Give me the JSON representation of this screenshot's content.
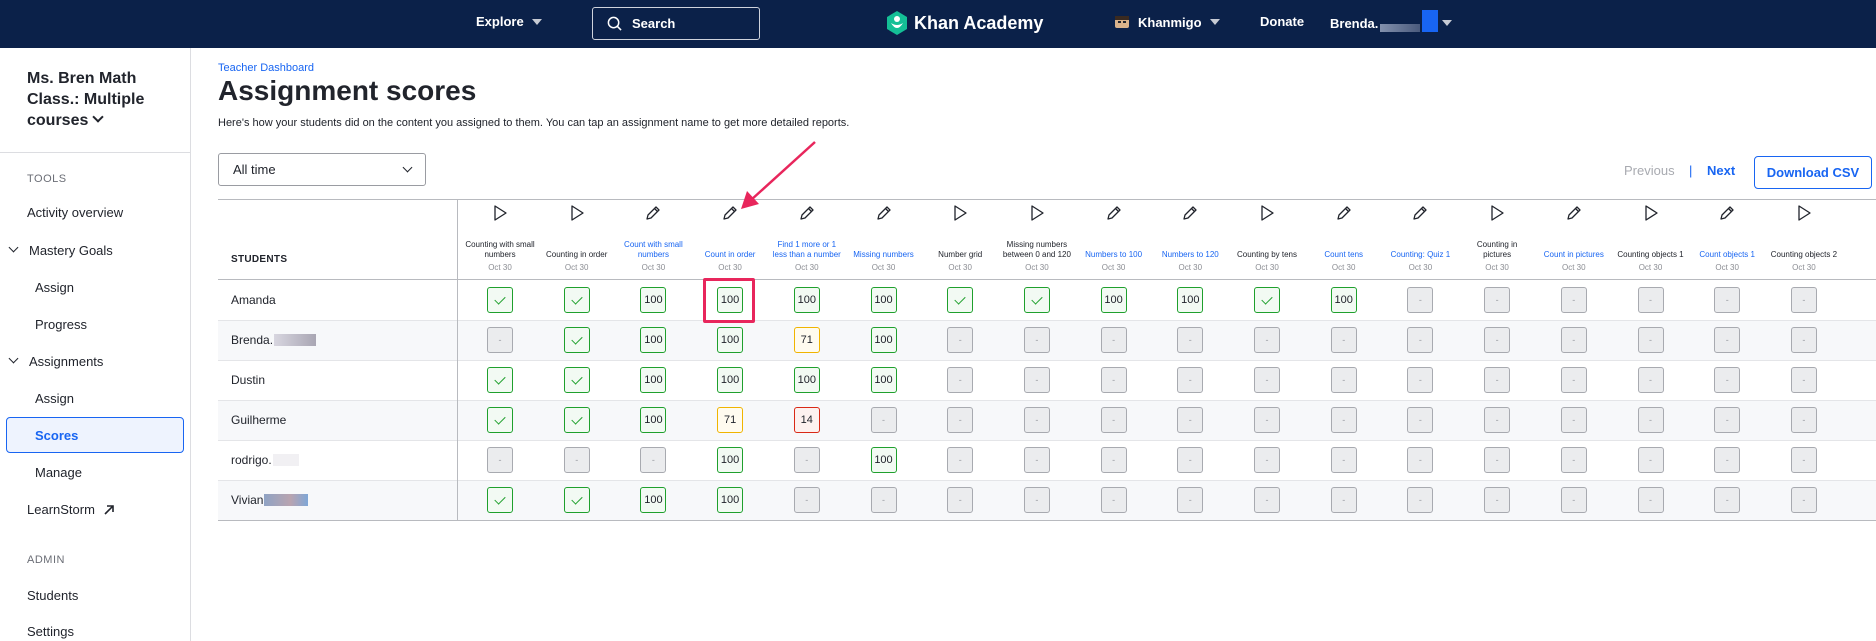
{
  "topbar": {
    "explore": "Explore",
    "search_placeholder": "Search",
    "logo": "Khan Academy",
    "khanmigo": "Khanmigo",
    "donate": "Donate",
    "user": "Brenda."
  },
  "sidebar": {
    "class_title": "Ms. Bren Math Class.: Multiple courses",
    "tools_label": "TOOLS",
    "activity_overview": "Activity overview",
    "mastery_goals": "Mastery Goals",
    "mastery_assign": "Assign",
    "mastery_progress": "Progress",
    "assignments": "Assignments",
    "assignments_assign": "Assign",
    "scores": "Scores",
    "manage": "Manage",
    "learnstorm": "LearnStorm",
    "admin_label": "ADMIN",
    "students": "Students",
    "settings": "Settings"
  },
  "main": {
    "breadcrumb": "Teacher Dashboard",
    "title": "Assignment scores",
    "subtitle": "Here's how your students did on the content you assigned to them. You can tap an assignment name to get more detailed reports.",
    "time_filter": "All time",
    "previous": "Previous",
    "separator": "|",
    "next": "Next",
    "download_csv": "Download CSV",
    "students_header": "STUDENTS"
  },
  "columns": [
    {
      "name": "Counting with small numbers",
      "date": "Oct 30",
      "icon": "play-icon",
      "linked": false
    },
    {
      "name": "Counting in order",
      "date": "Oct 30",
      "icon": "play-icon",
      "linked": false
    },
    {
      "name": "Count with small numbers",
      "date": "Oct 30",
      "icon": "pencil-icon",
      "linked": true
    },
    {
      "name": "Count in order",
      "date": "Oct 30",
      "icon": "pencil-icon",
      "linked": true
    },
    {
      "name": "Find 1 more or 1 less than a number",
      "date": "Oct 30",
      "icon": "pencil-icon",
      "linked": true
    },
    {
      "name": "Missing numbers",
      "date": "Oct 30",
      "icon": "pencil-icon",
      "linked": true
    },
    {
      "name": "Number grid",
      "date": "Oct 30",
      "icon": "play-icon",
      "linked": false
    },
    {
      "name": "Missing numbers between 0 and 120",
      "date": "Oct 30",
      "icon": "play-icon",
      "linked": false
    },
    {
      "name": "Numbers to 100",
      "date": "Oct 30",
      "icon": "pencil-icon",
      "linked": true
    },
    {
      "name": "Numbers to 120",
      "date": "Oct 30",
      "icon": "pencil-icon",
      "linked": true
    },
    {
      "name": "Counting by tens",
      "date": "Oct 30",
      "icon": "play-icon",
      "linked": false
    },
    {
      "name": "Count tens",
      "date": "Oct 30",
      "icon": "pencil-icon",
      "linked": true
    },
    {
      "name": "Counting: Quiz 1",
      "date": "Oct 30",
      "icon": "pencil-icon",
      "linked": true
    },
    {
      "name": "Counting in pictures",
      "date": "Oct 30",
      "icon": "play-icon",
      "linked": false
    },
    {
      "name": "Count in pictures",
      "date": "Oct 30",
      "icon": "pencil-icon",
      "linked": true
    },
    {
      "name": "Counting objects 1",
      "date": "Oct 30",
      "icon": "play-icon",
      "linked": false
    },
    {
      "name": "Count objects 1",
      "date": "Oct 30",
      "icon": "pencil-icon",
      "linked": true
    },
    {
      "name": "Counting objects 2",
      "date": "Oct 30",
      "icon": "play-icon",
      "linked": false
    }
  ],
  "students": [
    {
      "name": "Amanda",
      "scores": [
        "check",
        "check",
        "100",
        "100",
        "100",
        "100",
        "check",
        "check",
        "100",
        "100",
        "check",
        "100",
        "-",
        "-",
        "-",
        "-",
        "-",
        "-"
      ]
    },
    {
      "name": "Brenda.",
      "scores": [
        "-",
        "check",
        "100",
        "100",
        "71",
        "100",
        "-",
        "-",
        "-",
        "-",
        "-",
        "-",
        "-",
        "-",
        "-",
        "-",
        "-",
        "-"
      ]
    },
    {
      "name": "Dustin",
      "scores": [
        "check",
        "check",
        "100",
        "100",
        "100",
        "100",
        "-",
        "-",
        "-",
        "-",
        "-",
        "-",
        "-",
        "-",
        "-",
        "-",
        "-",
        "-"
      ]
    },
    {
      "name": "Guilherme",
      "scores": [
        "check",
        "check",
        "100",
        "71",
        "14",
        "-",
        "-",
        "-",
        "-",
        "-",
        "-",
        "-",
        "-",
        "-",
        "-",
        "-",
        "-",
        "-"
      ]
    },
    {
      "name": "rodrigo.",
      "scores": [
        "-",
        "-",
        "-",
        "100",
        "-",
        "100",
        "-",
        "-",
        "-",
        "-",
        "-",
        "-",
        "-",
        "-",
        "-",
        "-",
        "-",
        "-"
      ]
    },
    {
      "name": "Vivian",
      "scores": [
        "check",
        "check",
        "100",
        "100",
        "-",
        "-",
        "-",
        "-",
        "-",
        "-",
        "-",
        "-",
        "-",
        "-",
        "-",
        "-",
        "-",
        "-"
      ]
    }
  ],
  "colors": {
    "nav_bg": "#0b2149",
    "link_blue": "#1865f2",
    "pass_green": "#1fa02d",
    "warn_yellow": "#f0b400",
    "fail_red": "#d92916",
    "highlight_pink": "#e8265c",
    "logo_green": "#14bf96"
  }
}
